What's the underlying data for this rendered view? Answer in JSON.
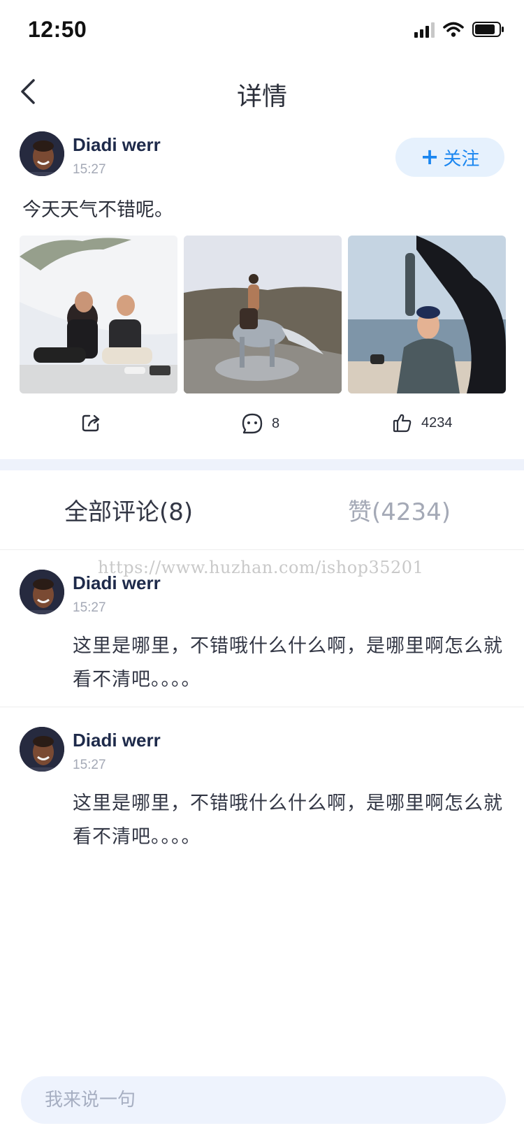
{
  "status_bar": {
    "time": "12:50"
  },
  "nav": {
    "title": "详情"
  },
  "post": {
    "author": "Diadi werr",
    "time": "15:27",
    "follow_label": "关注",
    "follow_plus": "+",
    "text": "今天天气不错呢。",
    "share_count": "",
    "comment_count": "8",
    "like_count": "4234"
  },
  "tabs": {
    "comments_label": "全部评论(8)",
    "likes_label": "赞(4234)"
  },
  "comments": [
    {
      "author": "Diadi werr",
      "time": "15:27",
      "text": "这里是哪里，不错哦什么什么啊，是哪里啊怎么就看不清吧。。。。"
    },
    {
      "author": "Diadi werr",
      "time": "15:27",
      "text": "这里是哪里，不错哦什么什么啊，是哪里啊怎么就看不清吧。。。。"
    }
  ],
  "watermark": "https://www.huzhan.com/ishop35201",
  "input": {
    "placeholder": "我来说一句"
  },
  "colors": {
    "accent": "#1a86f0",
    "follow_bg": "#e6f1fd",
    "section_bg": "#eef2fb",
    "input_bg": "#eef3fd"
  },
  "icons": [
    "back-arrow-icon",
    "share-icon",
    "comment-icon",
    "like-icon",
    "signal-icon",
    "wifi-icon",
    "battery-icon"
  ]
}
